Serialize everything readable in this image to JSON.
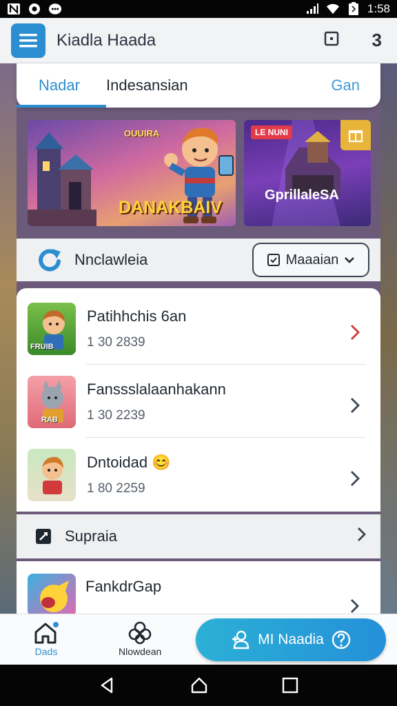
{
  "status_bar": {
    "time": "1:58",
    "left_icons": [
      "notification-n-icon",
      "location-icon",
      "chat-icon"
    ],
    "right_icons": [
      "signal-icon",
      "wifi-icon",
      "battery-icon"
    ]
  },
  "app_bar": {
    "title": "Kiadla Haada",
    "count": "3",
    "icons": [
      "menu-icon",
      "square-icon"
    ]
  },
  "tabs": [
    {
      "label": "Nadar",
      "active": true
    },
    {
      "label": "Indesansian",
      "active": false
    },
    {
      "label": "Gan",
      "active": false
    }
  ],
  "banners": [
    {
      "kicker": "OUUIRA",
      "title": "DANAKBAIV"
    },
    {
      "badge": "LE NUNI",
      "title": "GprillaleSA"
    }
  ],
  "section": {
    "title": "Nnclawleia",
    "filter_label": "Maaaian"
  },
  "list_items": [
    {
      "name": "Patihhchis 6an",
      "sub": "1 30 2839",
      "thumb_label": "FRUIB"
    },
    {
      "name": "Fanssslalaanhakann",
      "sub": "1 30 2239",
      "thumb_label": "RAB"
    },
    {
      "name": "Dntoidad",
      "sub": "1 80 2259",
      "emoji": "😊"
    }
  ],
  "support": {
    "label": "Supraia"
  },
  "partial_item": {
    "name": "FankdrGap"
  },
  "bottom_nav": {
    "home_label": "Dads",
    "second_label": "Nlowdean",
    "cta_label": "MI Naadia"
  },
  "colors": {
    "accent": "#2b8ed1",
    "cta_start": "#2bb0d6",
    "cta_end": "#2490d8",
    "chevron_red": "#d0383c"
  }
}
